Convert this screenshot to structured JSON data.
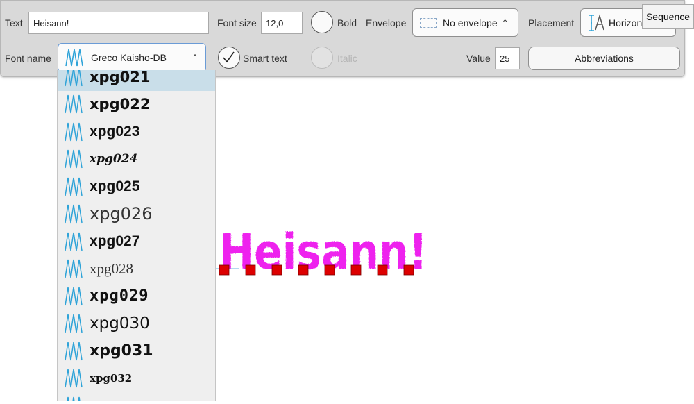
{
  "toolbar": {
    "text_label": "Text",
    "text_value": "Heisann!",
    "font_size_label": "Font size",
    "font_size_value": "12,0",
    "bold_label": "Bold",
    "envelope_label": "Envelope",
    "envelope_value": "No envelope",
    "placement_label": "Placement",
    "placement_value": "Horizon",
    "font_name_label": "Font name",
    "font_name_value": "Greco Kaisho-DB",
    "smart_text_label": "Smart text",
    "italic_label": "Italic",
    "value_label": "Value",
    "value_value": "25",
    "abbreviations_label": "Abbreviations",
    "smart_text_checked": true,
    "bold_checked": false,
    "italic_enabled": false
  },
  "tooltip": {
    "text": "Sequence"
  },
  "font_list": {
    "items": [
      {
        "name": "xpg021",
        "selected": true
      },
      {
        "name": "xpg022",
        "selected": false
      },
      {
        "name": "xpg023",
        "selected": false
      },
      {
        "name": "xpg024",
        "selected": false
      },
      {
        "name": "xpg025",
        "selected": false
      },
      {
        "name": "xpg026",
        "selected": false
      },
      {
        "name": "xpg027",
        "selected": false
      },
      {
        "name": "xpg028",
        "selected": false
      },
      {
        "name": "xpg029",
        "selected": false
      },
      {
        "name": "xpg030",
        "selected": false
      },
      {
        "name": "xpg031",
        "selected": false
      },
      {
        "name": "xpg032",
        "selected": false
      }
    ],
    "icon": "embroidery-zigzag-icon"
  },
  "canvas": {
    "text": "Heisann!",
    "text_color": "#ee22ee",
    "handle_color": "#dd0000",
    "handle_count": 8
  },
  "colors": {
    "toolbar_bg": "#d9d9d9",
    "selected_row": "#c9dee9",
    "icon_blue": "#2ea3d8"
  }
}
